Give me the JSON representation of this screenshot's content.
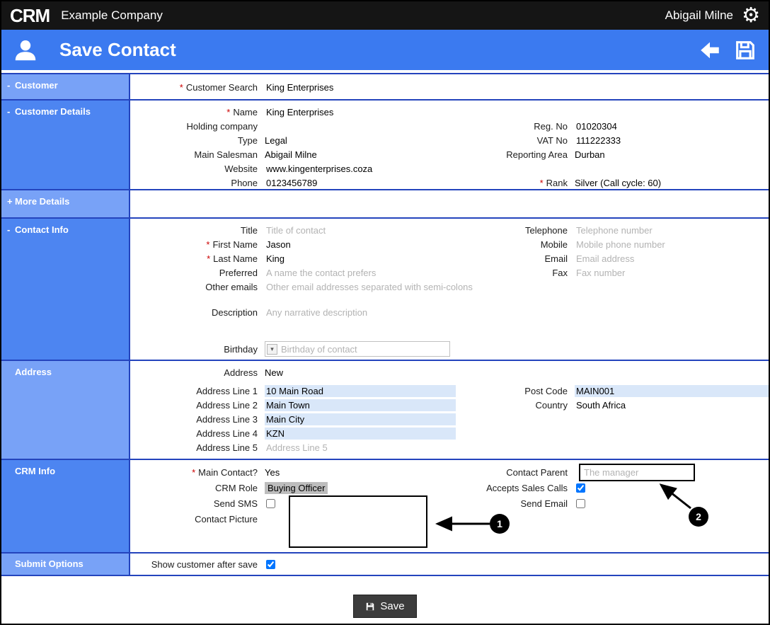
{
  "ui": {
    "required_marker": "*",
    "dropdown_glyph": "▾"
  },
  "icons": {
    "gear": "⚙"
  },
  "topbar": {
    "logo": "CRM",
    "company": "Example Company",
    "user": "Abigail Milne"
  },
  "header": {
    "title": "Save Contact"
  },
  "sidebar": {
    "items": [
      {
        "toggle": "-",
        "label": "Customer"
      },
      {
        "toggle": "-",
        "label": "Customer Details"
      },
      {
        "toggle": "+",
        "label": "More Details"
      },
      {
        "toggle": "-",
        "label": "Contact Info"
      },
      {
        "toggle": "",
        "label": "Address"
      },
      {
        "toggle": "",
        "label": "CRM Info"
      },
      {
        "toggle": "",
        "label": "Submit Options"
      }
    ]
  },
  "customer": {
    "search_label": "Customer Search",
    "search_value": "King Enterprises"
  },
  "details": {
    "name_label": "Name",
    "name_value": "King Enterprises",
    "holding_label": "Holding company",
    "holding_value": "",
    "type_label": "Type",
    "type_value": "Legal",
    "salesman_label": "Main Salesman",
    "salesman_value": "Abigail Milne",
    "website_label": "Website",
    "website_value": "www.kingenterprises.coza",
    "phone_label": "Phone",
    "phone_value": "0123456789",
    "regno_label": "Reg. No",
    "regno_value": "01020304",
    "vat_label": "VAT No",
    "vat_value": "111222333",
    "area_label": "Reporting Area",
    "area_value": "Durban",
    "rank_label": "Rank",
    "rank_value": "Silver (Call cycle: 60)"
  },
  "contact": {
    "title_label": "Title",
    "title_placeholder": "Title of contact",
    "first_label": "First Name",
    "first_value": "Jason",
    "last_label": "Last Name",
    "last_value": "King",
    "preferred_label": "Preferred",
    "preferred_placeholder": "A name the contact prefers",
    "other_label": "Other emails",
    "other_placeholder": "Other email addresses separated with semi-colons",
    "description_label": "Description",
    "description_placeholder": "Any narrative description",
    "birthday_label": "Birthday",
    "birthday_placeholder": "Birthday of contact",
    "telephone_label": "Telephone",
    "telephone_placeholder": "Telephone number",
    "mobile_label": "Mobile",
    "mobile_placeholder": "Mobile phone number",
    "email_label": "Email",
    "email_placeholder": "Email address",
    "fax_label": "Fax",
    "fax_placeholder": "Fax number"
  },
  "address": {
    "address_label": "Address",
    "address_value": "New",
    "line1_label": "Address Line 1",
    "line1_value": "10 Main Road",
    "line2_label": "Address Line 2",
    "line2_value": "Main Town",
    "line3_label": "Address Line 3",
    "line3_value": "Main City",
    "line4_label": "Address Line 4",
    "line4_value": "KZN",
    "line5_label": "Address Line 5",
    "line5_placeholder": "Address Line 5",
    "postcode_label": "Post Code",
    "postcode_value": "MAIN001",
    "country_label": "Country",
    "country_value": "South Africa"
  },
  "crm_info": {
    "main_contact_label": "Main Contact?",
    "main_contact_value": "Yes",
    "role_label": "CRM Role",
    "role_value": "Buying Officer",
    "send_sms_label": "Send SMS",
    "send_sms_checked": false,
    "picture_label": "Contact Picture",
    "parent_label": "Contact Parent",
    "parent_placeholder": "The manager",
    "accepts_label": "Accepts Sales Calls",
    "accepts_checked": true,
    "send_email_label": "Send Email",
    "send_email_checked": false
  },
  "submit": {
    "show_label": "Show customer after save",
    "show_checked": true
  },
  "footer": {
    "save_label": "Save"
  },
  "annotations": {
    "badge1": "1",
    "badge2": "2"
  }
}
